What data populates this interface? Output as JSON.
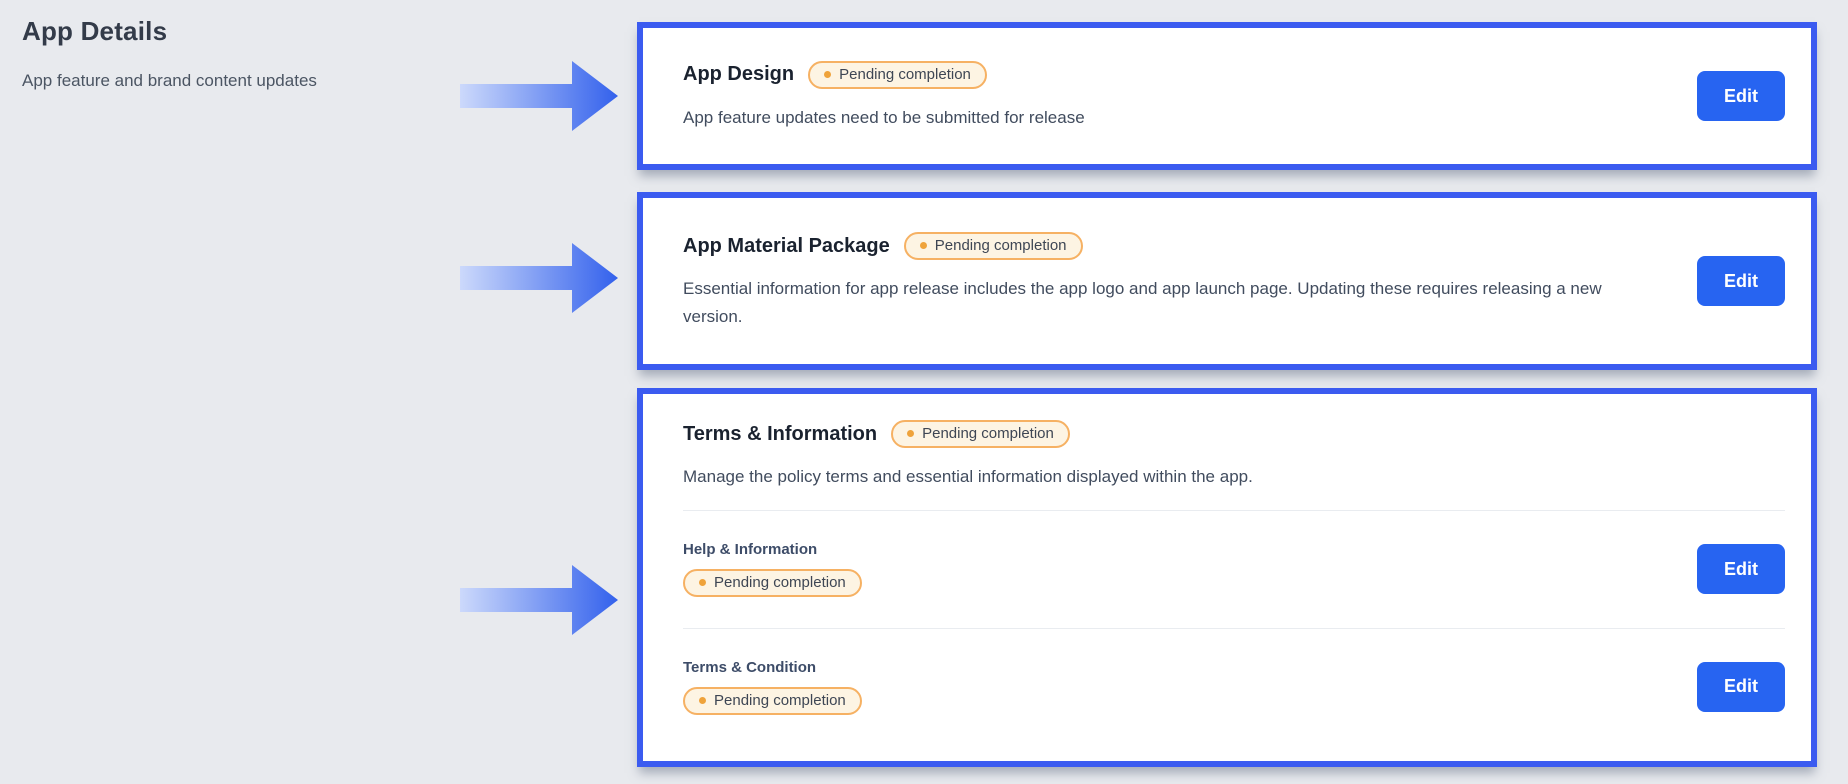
{
  "page": {
    "title": "App Details",
    "subtitle": "App feature and brand content updates"
  },
  "cards": [
    {
      "title": "App Design",
      "badge": "Pending completion",
      "description": "App feature updates need to be submitted for release",
      "edit_label": "Edit"
    },
    {
      "title": "App Material Package",
      "badge": "Pending completion",
      "description": "Essential information for app release includes the app logo and app launch page. Updating these requires releasing a new version.",
      "edit_label": "Edit"
    },
    {
      "title": "Terms & Information",
      "badge": "Pending completion",
      "description": "Manage the policy terms and essential information displayed within the app.",
      "sub_items": [
        {
          "label": "Help & Information",
          "badge": "Pending completion",
          "edit_label": "Edit"
        },
        {
          "label": "Terms & Condition",
          "badge": "Pending completion",
          "edit_label": "Edit"
        }
      ]
    }
  ],
  "icons": {
    "arrow_right": "→",
    "status_dot": "•"
  },
  "colors": {
    "page_background": "#e8eaee",
    "highlight_border_blue": "#3b5bf0",
    "edit_button_blue": "#2764f1",
    "badge_border_orange": "#f6b163",
    "badge_background": "#fdf4e3",
    "badge_dot_orange": "#efa33b",
    "arrow_gradient_start": "#ccd9fb",
    "arrow_gradient_end": "#3361ec"
  }
}
